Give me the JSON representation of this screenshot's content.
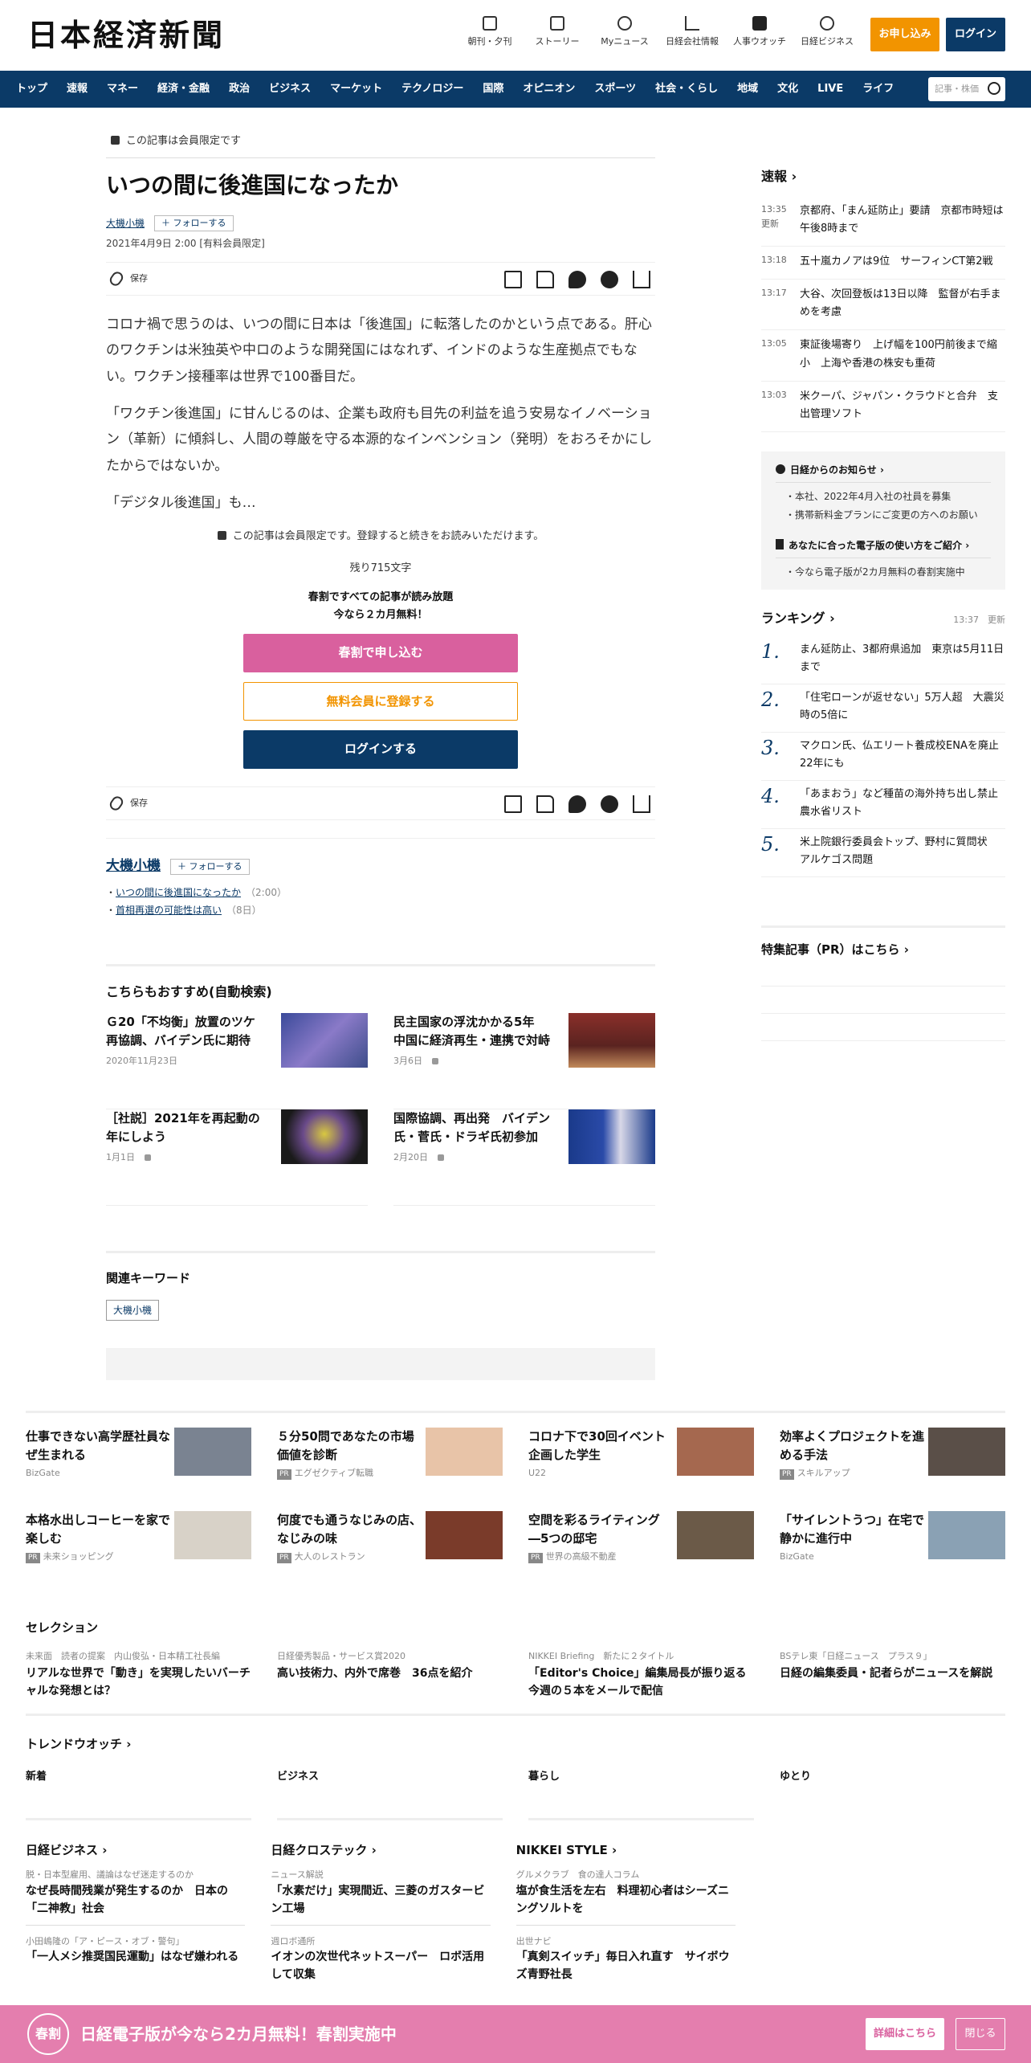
{
  "header": {
    "logo": "日本経済新聞",
    "icons": [
      {
        "label": "朝刊・夕刊",
        "icon": "newspaper-icon"
      },
      {
        "label": "ストーリー",
        "icon": "document-icon"
      },
      {
        "label": "Myニュース",
        "icon": "user-icon"
      },
      {
        "label": "日経会社情報",
        "icon": "chart-icon"
      },
      {
        "label": "人事ウオッチ",
        "icon": "search-icon"
      },
      {
        "label": "日経ビジネス",
        "icon": "compass-icon"
      }
    ],
    "apply_label": "お申し込み",
    "login_label": "ログイン"
  },
  "nav": {
    "items": [
      "トップ",
      "速報",
      "マネー",
      "経済・金融",
      "政治",
      "ビジネス",
      "マーケット",
      "テクノロジー",
      "国際",
      "オピニオン",
      "スポーツ",
      "社会・くらし",
      "地域",
      "文化",
      "LIVE",
      "ライフ"
    ],
    "search_placeholder": "記事・株価"
  },
  "article": {
    "members_only": "この記事は会員限定です",
    "title": "いつの間に後進国になったか",
    "author": "大機小機",
    "follow": "フォローする",
    "date": "2021年4月9日 2:00 [有料会員限定]",
    "save": "保存",
    "paragraphs": [
      "コロナ禍で思うのは、いつの間に日本は「後進国」に転落したのかという点である。肝心のワクチンは米独英や中ロのような開発国にはなれず、インドのような生産拠点でもない。ワクチン接種率は世界で100番目だ。",
      "「ワクチン後進国」に甘んじるのは、企業も政府も目先の利益を追う安易なイノベーション（革新）に傾斜し、人間の尊厳を守る本源的なインベンション（発明）をおろそかにしたからではないか。",
      "「デジタル後進国」も…"
    ],
    "paywall_note": "この記事は会員限定です。登録すると続きをお読みいただけます。",
    "remaining": "残り715文字",
    "promo_line1": "春割ですべての記事が読み放題",
    "promo_line2": "今なら２カ月無料！",
    "btn_spring": "春割で申し込む",
    "btn_free": "無料会員に登録する",
    "btn_login": "ログインする"
  },
  "author_box": {
    "name": "大機小機",
    "follow": "フォローする",
    "items": [
      {
        "title": "いつの間に後進国になったか",
        "date": "（2:00）"
      },
      {
        "title": "首相再選の可能性は高い",
        "date": "（8日）"
      }
    ]
  },
  "recommend": {
    "title": "こちらもおすすめ(自動検索)",
    "items": [
      {
        "title": "Ｇ20「不均衡」放置のツケ　再協調、バイデン氏に期待",
        "date": "2020年11月23日",
        "locked": false
      },
      {
        "title": "民主国家の浮沈かかる5年　中国に経済再生・連携で対峙",
        "date": "3月6日",
        "locked": true
      },
      {
        "title": "［社説］2021年を再起動の年にしよう",
        "date": "1月1日",
        "locked": true
      },
      {
        "title": "国際協調、再出発　バイデン氏・菅氏・ドラギ氏初参加",
        "date": "2月20日",
        "locked": true
      }
    ]
  },
  "keywords": {
    "title": "関連キーワード",
    "tags": [
      "大機小機"
    ]
  },
  "side": {
    "news_title": "速報",
    "news": [
      {
        "time": "13:35",
        "extra": "更新",
        "text": "京都府、「まん延防止」要請　京都市時短は午後8時まで"
      },
      {
        "time": "13:18",
        "extra": "",
        "text": "五十嵐カノアは9位　サーフィンCT第2戦"
      },
      {
        "time": "13:17",
        "extra": "",
        "text": "大谷、次回登板は13日以降　監督が右手まめを考慮"
      },
      {
        "time": "13:05",
        "extra": "",
        "text": "東証後場寄り　上げ幅を100円前後まで縮小　上海や香港の株安も重荷"
      },
      {
        "time": "13:03",
        "extra": "",
        "text": "米クーパ、ジャパン・クラウドと合弁　支出管理ソフト"
      }
    ],
    "info_title": "日経からのお知らせ",
    "info_items": [
      "本社、2022年4月入社の社員を募集",
      "携帯新料金プランにご変更の方へのお願い"
    ],
    "guide_title": "あなたに合った電子版の使い方をご紹介",
    "guide_items": [
      "今なら電子版が2カ月無料の春割実施中"
    ],
    "ranking_title": "ランキング",
    "ranking_time": "13:37　更新",
    "ranking": [
      {
        "n": "1.",
        "text": "まん延防止、3都府県追加　東京は5月11日まで"
      },
      {
        "n": "2.",
        "text": "「住宅ローンが返せない」5万人超　大震災時の5倍に"
      },
      {
        "n": "3.",
        "text": "マクロン氏、仏エリート養成校ENAを廃止　22年にも"
      },
      {
        "n": "4.",
        "text": "「あまおう」など種苗の海外持ち出し禁止　農水省リスト"
      },
      {
        "n": "5.",
        "text": "米上院銀行委員会トップ、野村に質問状　アルケゴス問題"
      }
    ],
    "pr_title": "特集記事（PR）はこちら"
  },
  "ads": [
    {
      "title": "仕事できない高学歴社員なぜ生まれる",
      "src": "BizGate",
      "pr": false,
      "color": "#7a8391"
    },
    {
      "title": "５分50問であなたの市場価値を診断",
      "src": "エグゼクティブ転職",
      "pr": true,
      "color": "#e8c4a8"
    },
    {
      "title": "コロナ下で30回イベント企画した学生",
      "src": "U22",
      "pr": false,
      "color": "#a5684f"
    },
    {
      "title": "効率よくプロジェクトを進める手法",
      "src": "スキルアップ",
      "pr": true,
      "color": "#5a4f48"
    },
    {
      "title": "本格水出しコーヒーを家で楽しむ",
      "src": "未来ショッピング",
      "pr": true,
      "color": "#d8d2c8"
    },
    {
      "title": "何度でも通うなじみの店、なじみの味",
      "src": "大人のレストラン",
      "pr": true,
      "color": "#7a3b2a"
    },
    {
      "title": "空間を彩るライティング―5つの邸宅",
      "src": "世界の高級不動産",
      "pr": true,
      "color": "#6b5a48"
    },
    {
      "title": "「サイレントうつ」在宅で静かに進行中",
      "src": "BizGate",
      "pr": false,
      "color": "#8aa1b4"
    }
  ],
  "selection": {
    "title": "セレクション",
    "items": [
      {
        "kicker": "未来面　読者の提案　内山俊弘・日本精工社長編",
        "title": "リアルな世界で「動き」を実現したいバーチャルな発想とは？"
      },
      {
        "kicker": "日経優秀製品・サービス賞2020",
        "title": "高い技術力、内外で席巻　36点を紹介"
      },
      {
        "kicker": "NIKKEI Briefing　新たに２タイトル",
        "title": "「Editor's Choice」編集局長が振り返る今週の５本をメールで配信"
      },
      {
        "kicker": "BSテレ東「日経ニュース　プラス９」",
        "title": "日経の編集委員・記者らがニュースを解説"
      }
    ]
  },
  "trend": {
    "title": "トレンドウオッチ",
    "cols": [
      "新着",
      "ビジネス",
      "暮らし",
      "ゆとり"
    ]
  },
  "media": [
    {
      "name": "日経ビジネス",
      "items": [
        {
          "kicker": "脱・日本型雇用、議論はなぜ迷走するのか",
          "title": "なぜ長時間残業が発生するのか　日本の「二神教」社会"
        },
        {
          "kicker": "小田嶋隆の「ア・ピース・オブ・警句」",
          "title": "「一人メシ推奨国民運動」はなぜ嫌われる"
        }
      ]
    },
    {
      "name": "日経クロステック",
      "items": [
        {
          "kicker": "ニュース解説",
          "title": "「水素だけ」実現間近、三菱のガスタービン工場"
        },
        {
          "kicker": "週ロボ通所",
          "title": "イオンの次世代ネットスーパー　ロボ活用して収集"
        }
      ]
    },
    {
      "name": "NIKKEI STYLE",
      "items": [
        {
          "kicker": "グルメクラブ　食の達人コラム",
          "title": "塩が食生活を左右　料理初心者はシーズニングソルトを"
        },
        {
          "kicker": "出世ナビ",
          "title": "「真剣スイッチ」毎日入れ直す　サイボウズ青野社長"
        }
      ]
    }
  ],
  "banner": {
    "seal": "春割",
    "text": "日経電子版が今なら2カ月無料！春割実施中",
    "detail": "詳細はこちら",
    "close": "閉じる"
  }
}
